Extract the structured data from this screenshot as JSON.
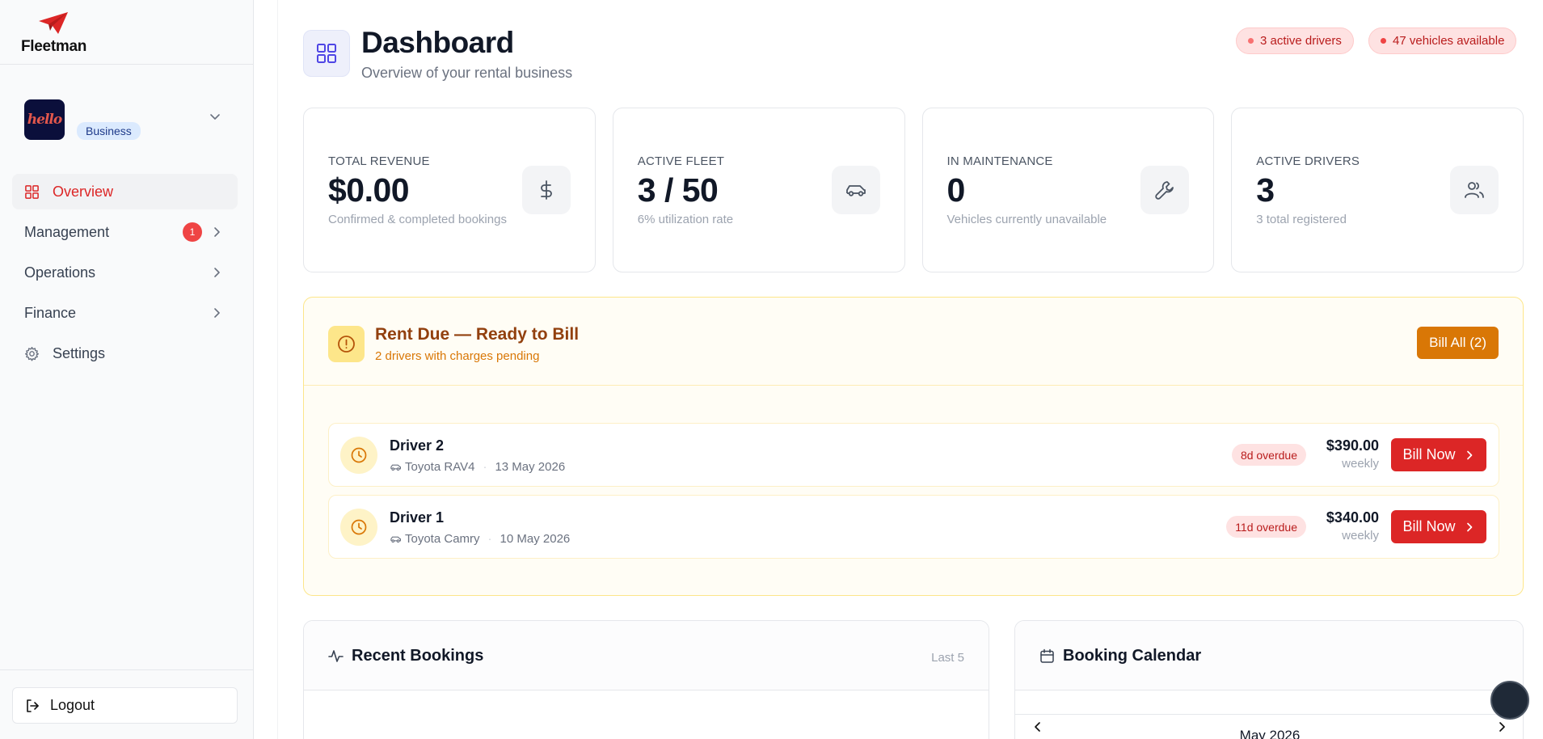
{
  "brand": {
    "name": "Fleetman",
    "color": "#dc2626"
  },
  "org": {
    "avatar_text": "hello",
    "badge": "Business"
  },
  "nav": {
    "overview": "Overview",
    "management": "Management",
    "management_badge": "1",
    "operations": "Operations",
    "finance": "Finance",
    "settings": "Settings",
    "logout": "Logout"
  },
  "header": {
    "title": "Dashboard",
    "subtitle": "Overview of your rental business",
    "pill_drivers": "3 active drivers",
    "pill_vehicles": "47 vehicles available"
  },
  "stats": [
    {
      "label": "TOTAL REVENUE",
      "value": "$0.00",
      "sub": "Confirmed & completed bookings",
      "icon": "dollar-icon"
    },
    {
      "label": "ACTIVE FLEET",
      "value": "3 / 50",
      "sub": "6% utilization rate",
      "icon": "car-icon"
    },
    {
      "label": "IN MAINTENANCE",
      "value": "0",
      "sub": "Vehicles currently unavailable",
      "icon": "wrench-icon"
    },
    {
      "label": "ACTIVE DRIVERS",
      "value": "3",
      "sub": "3 total registered",
      "icon": "users-icon"
    }
  ],
  "rent_due": {
    "title": "Rent Due — Ready to Bill",
    "subtitle": "2 drivers with charges pending",
    "bill_all": "Bill All (2)",
    "drivers": [
      {
        "name": "Driver 2",
        "vehicle": "Toyota RAV4",
        "date": "13 May 2026",
        "overdue": "8d overdue",
        "amount": "$390.00",
        "period": "weekly",
        "action": "Bill Now"
      },
      {
        "name": "Driver 1",
        "vehicle": "Toyota Camry",
        "date": "10 May 2026",
        "overdue": "11d overdue",
        "amount": "$340.00",
        "period": "weekly",
        "action": "Bill Now"
      }
    ]
  },
  "recent_bookings": {
    "title": "Recent Bookings",
    "meta": "Last 5"
  },
  "calendar": {
    "title": "Booking Calendar",
    "month": "May 2026"
  },
  "separator": "·"
}
